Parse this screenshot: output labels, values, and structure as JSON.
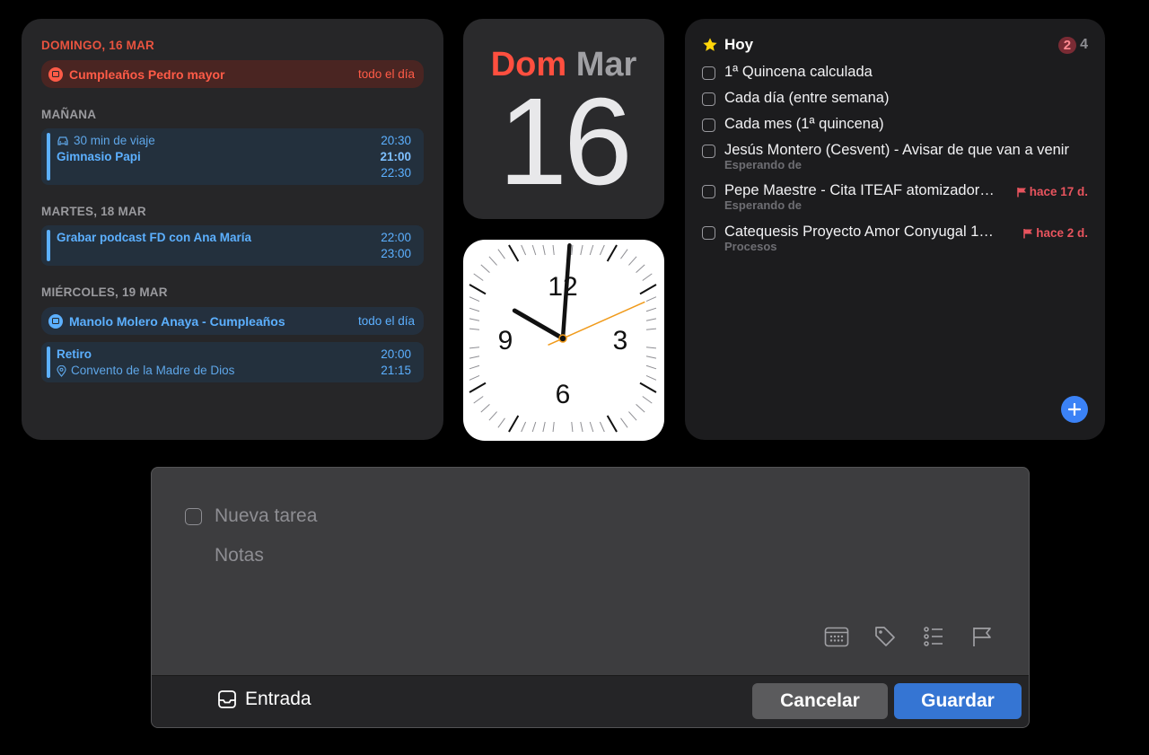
{
  "calendar": {
    "today_header": "DOMINGO, 16 MAR",
    "today_allday": {
      "title": "Cumpleaños Pedro mayor",
      "time": "todo el día"
    },
    "tomorrow_header": "MAÑANA",
    "tomorrow_event": {
      "travel": "30 min de viaje",
      "travel_time": "20:30",
      "title": "Gimnasio Papi",
      "start": "21:00",
      "end": "22:30"
    },
    "tuesday_header": "MARTES, 18 MAR",
    "tuesday_event": {
      "title": "Grabar podcast FD con Ana María",
      "start": "22:00",
      "end": "23:00"
    },
    "wednesday_header": "MIÉRCOLES, 19 MAR",
    "wednesday_allday": {
      "title": "Manolo Molero Anaya - Cumpleaños",
      "time": "todo el día"
    },
    "wednesday_event": {
      "title": "Retiro",
      "location": "Convento de la Madre de Dios",
      "start": "20:00",
      "end": "21:15"
    }
  },
  "date_widget": {
    "day_of_week": "Dom",
    "month": "Mar",
    "day": "16"
  },
  "clock": {
    "numerals": {
      "n12": "12",
      "n3": "3",
      "n6": "6",
      "n9": "9"
    },
    "hour": 10,
    "minute": 0,
    "second": 41
  },
  "reminders": {
    "title": "Hoy",
    "overdue_count": "2",
    "total_count": "4",
    "items": [
      {
        "text": "1ª Quincena calculada"
      },
      {
        "text": "Cada día (entre semana)"
      },
      {
        "text": "Cada mes (1ª quincena)"
      },
      {
        "text": "Jesús Montero (Cesvent) - Avisar de que van a venir",
        "list": "Esperando de"
      },
      {
        "text": "Pepe Maestre - Cita ITEAF atomizador…",
        "list": "Esperando de",
        "flag": "hace 17 d."
      },
      {
        "text": "Catequesis Proyecto Amor Conyugal 1…",
        "list": "Procesos",
        "flag": "hace 2 d."
      }
    ]
  },
  "quick_entry": {
    "task_placeholder": "Nueva tarea",
    "notes_placeholder": "Notas",
    "inbox_label": "Entrada",
    "cancel_label": "Cancelar",
    "save_label": "Guardar"
  }
}
